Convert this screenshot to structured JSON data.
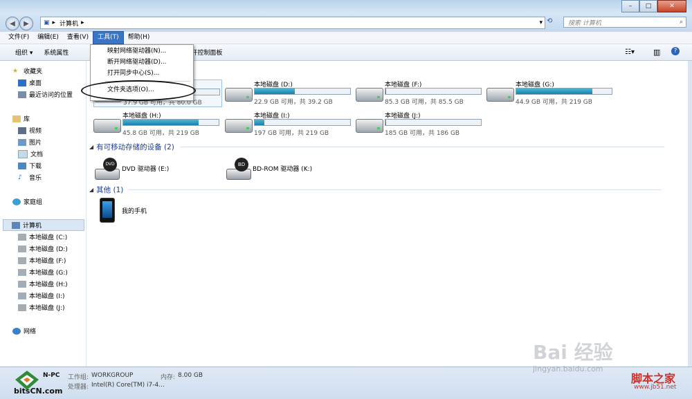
{
  "window": {
    "minimize": "–",
    "maximize": "□",
    "close": "✕"
  },
  "address": {
    "path": "计算机",
    "search_placeholder": "搜索 计算机"
  },
  "menubar": [
    "文件(F)",
    "编辑(E)",
    "查看(V)",
    "工具(T)",
    "帮助(H)"
  ],
  "toolbar": {
    "organize": "组织 ▾",
    "system_properties": "系统属性",
    "control_panel": "打开控制面板"
  },
  "tools_menu": [
    "映射网络驱动器(N)...",
    "断开网络驱动器(D)...",
    "打开同步中心(S)...",
    "文件夹选项(O)..."
  ],
  "sidebar": {
    "favorites": "收藏夹",
    "desktop": "桌面",
    "recent": "最近访问的位置",
    "libraries": "库",
    "videos": "视频",
    "pictures": "图片",
    "documents": "文档",
    "downloads": "下载",
    "music": "音乐",
    "homegroup": "家庭组",
    "computer": "计算机",
    "drives": [
      "本地磁盘 (C:)",
      "本地磁盘 (D:)",
      "本地磁盘 (F:)",
      "本地磁盘 (G:)",
      "本地磁盘 (H:)",
      "本地磁盘 (I:)",
      "本地磁盘 (J:)"
    ],
    "network": "网络"
  },
  "hard_drives": [
    {
      "name": "",
      "size": "37.9 GB 可用，共 80.0 GB",
      "used": 0.53
    },
    {
      "name": "本地磁盘 (D:)",
      "size": "22.9 GB 可用，共 39.2 GB",
      "used": 0.42
    },
    {
      "name": "本地磁盘 (F:)",
      "size": "85.3 GB 可用，共 85.5 GB",
      "used": 0.01
    },
    {
      "name": "本地磁盘 (G:)",
      "size": "44.9 GB 可用，共 219 GB",
      "used": 0.8
    },
    {
      "name": "本地磁盘 (H:)",
      "size": "45.8 GB 可用，共 219 GB",
      "used": 0.79
    },
    {
      "name": "本地磁盘 (I:)",
      "size": "197 GB 可用，共 219 GB",
      "used": 0.1
    },
    {
      "name": "本地磁盘 (J:)",
      "size": "185 GB 可用，共 186 GB",
      "used": 0.01
    }
  ],
  "removable": {
    "header": "有可移动存储的设备 (2)",
    "dvd": "DVD 驱动器 (E:)",
    "bd": "BD-ROM 驱动器 (K:)",
    "dvd_badge": "DVD",
    "bd_badge": "BD"
  },
  "other": {
    "header": "其他 (1)",
    "phone": "我的手机"
  },
  "status": {
    "pc": "N-PC",
    "workgroup_label": "工作组:",
    "workgroup": "WORKGROUP",
    "memory_label": "内存:",
    "memory": "8.00 GB",
    "cpu_label": "处理器:",
    "cpu": "Intel(R) Core(TM) i7-4..."
  },
  "watermarks": {
    "bitscn": "bitsCN.com",
    "baidu": "Bai 经验",
    "baidu_url": "jingyan.baidu.com",
    "jb51": "脚本之家",
    "jb51_url": "www.jb51.net"
  }
}
